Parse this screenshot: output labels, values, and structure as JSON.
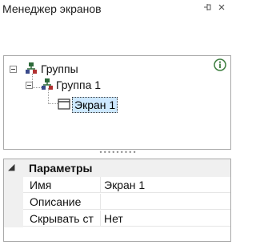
{
  "window": {
    "title": "Менеджер экранов",
    "pin_icon": "pin-icon",
    "close_icon": "close-icon"
  },
  "tree": {
    "nodes": [
      {
        "label": "Группы",
        "icon": "group-icon",
        "expanded": true
      },
      {
        "label": "Группа 1",
        "icon": "group-icon",
        "expanded": true
      },
      {
        "label": "Экран 1",
        "icon": "screen-window-icon",
        "selected": true
      }
    ],
    "info_icon": "info-icon"
  },
  "properties": {
    "category": "Параметры",
    "rows": [
      {
        "name": "Имя",
        "value": "Экран 1"
      },
      {
        "name": "Описание",
        "value": ""
      },
      {
        "name": "Скрывать ст",
        "value": "Нет"
      }
    ]
  },
  "colors": {
    "selection": "#cde8ff",
    "group_icon": "#2d6a3a",
    "info_icon": "#3c7d3e",
    "border": "#a9a9a9"
  }
}
